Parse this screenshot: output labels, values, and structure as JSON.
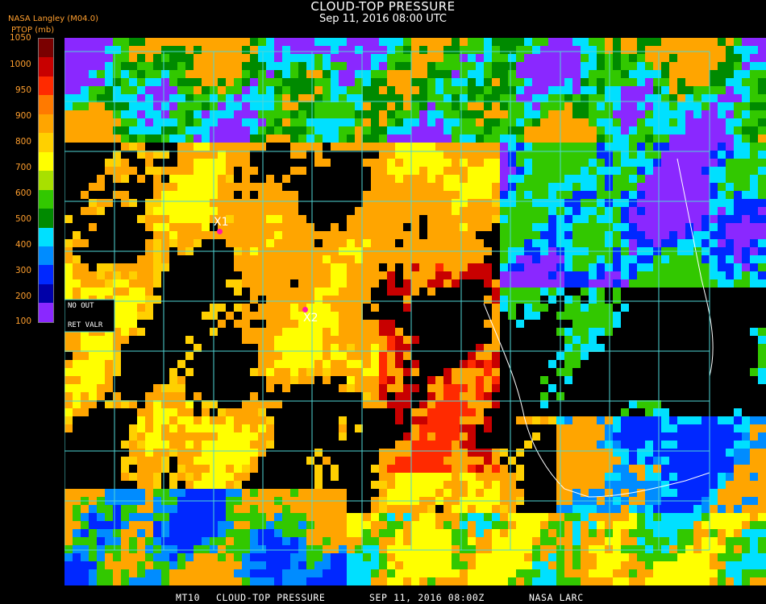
{
  "header": {
    "title": "CLOUD-TOP PRESSURE",
    "subtitle": "Sep 11, 2016 08:00 UTC",
    "agency": "NASA Langley (M04.0)",
    "unit": "PTOP (mb)"
  },
  "legend": {
    "ticks": [
      "1050",
      "1000",
      "950",
      "900",
      "850",
      "800",
      "750",
      "700",
      "650",
      "600",
      "550",
      "500",
      "450",
      "400",
      "350",
      "300",
      "250",
      "200",
      "150",
      "100"
    ],
    "visible_ticks": [
      "1050",
      "1000",
      "950",
      "900",
      "800",
      "700",
      "600",
      "500",
      "400",
      "300",
      "200",
      "100"
    ],
    "colors": [
      "#7a0000",
      "#c80000",
      "#ff2a00",
      "#ff7a00",
      "#ffa500",
      "#ffd000",
      "#ffff00",
      "#a8e000",
      "#32c800",
      "#008a00",
      "#00e0ff",
      "#008cff",
      "#0028ff",
      "#0000a8",
      "#8a28ff"
    ]
  },
  "overlay_labels": {
    "no_out": "NO   OUT",
    "ret_valr": "RET   VALR"
  },
  "markers": [
    {
      "label": "X1"
    },
    {
      "label": "X2"
    }
  ],
  "footer": {
    "sat": "MT10",
    "product": "CLOUD-TOP PRESSURE",
    "datetime": "SEP 11, 2016 08:00Z",
    "source": "NASA LARC"
  },
  "colors": {
    "grid": "#4fd6d6",
    "coast": "#ffffff",
    "legend_text": "#ff9f2e",
    "marker": "#ff1aa8"
  }
}
